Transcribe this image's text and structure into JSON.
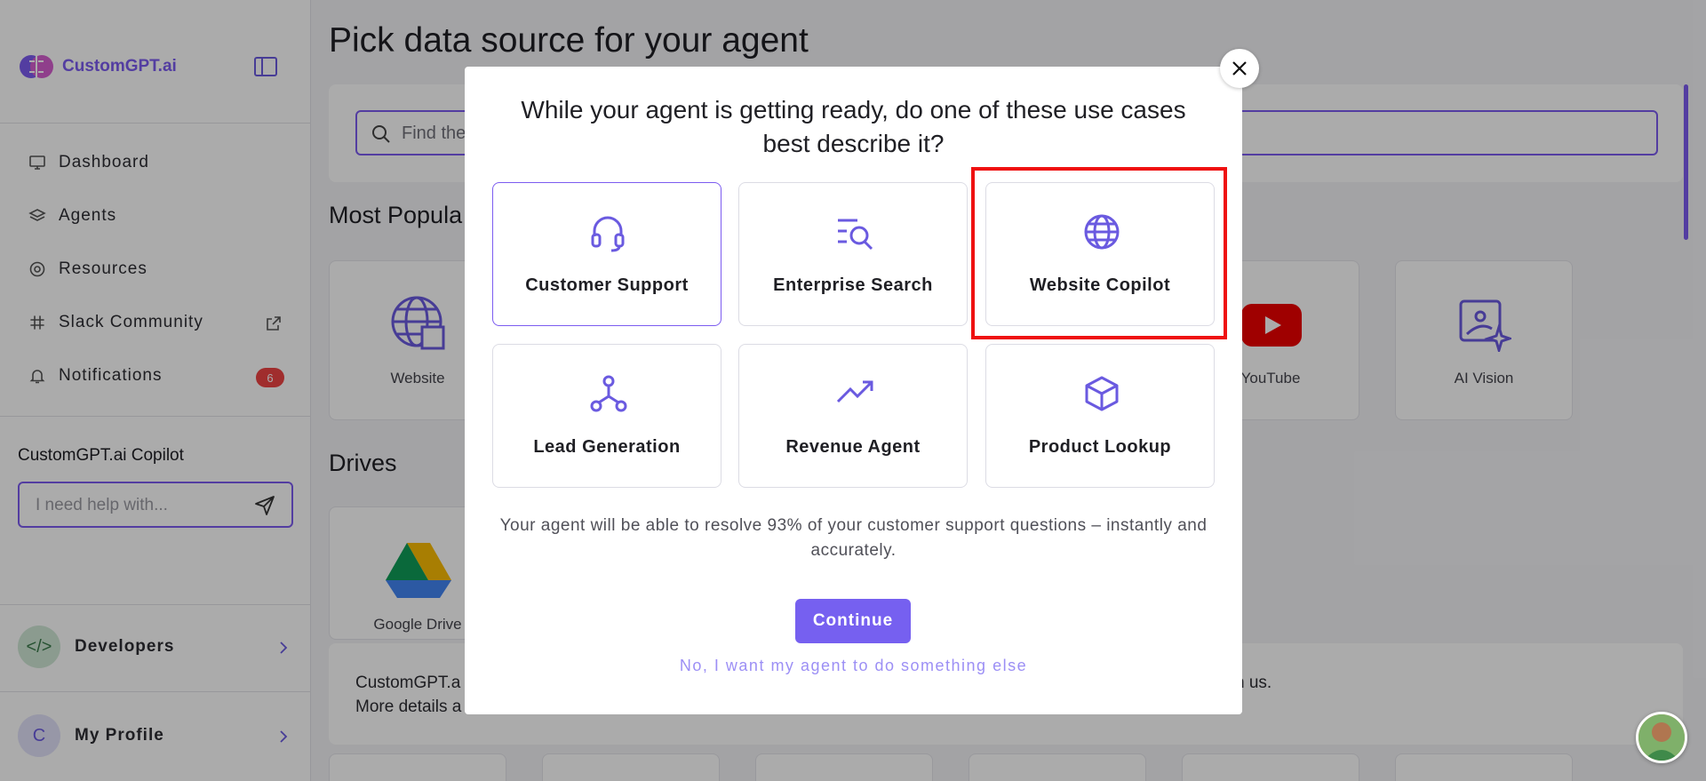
{
  "sidebar": {
    "brand": "CustomGPT.ai",
    "nav": [
      {
        "label": "Dashboard",
        "icon": "dashboard-icon"
      },
      {
        "label": "Agents",
        "icon": "layers-icon"
      },
      {
        "label": "Resources",
        "icon": "lifebuoy-icon"
      },
      {
        "label": "Slack Community",
        "icon": "slack-icon"
      },
      {
        "label": "Notifications",
        "icon": "bell-icon",
        "badge": "6"
      }
    ],
    "copilot": {
      "title": "CustomGPT.ai Copilot",
      "placeholder": "I need help with..."
    },
    "developers": {
      "label": "Developers"
    },
    "profile": {
      "label": "My Profile",
      "initial": "C"
    }
  },
  "main": {
    "title": "Pick data source for your agent",
    "search_placeholder": "Find the",
    "most_popular": "Most Popula",
    "cards": [
      {
        "label": "Website",
        "icon": "globe-link-icon"
      },
      {
        "label": "YouTube",
        "icon": "youtube-icon"
      },
      {
        "label": "AI Vision",
        "icon": "ai-vision-icon"
      }
    ],
    "drives_title": "Drives",
    "drive_cards": [
      {
        "label": "Google Drive",
        "icon": "google-drive-icon"
      }
    ],
    "info_line1_left": "CustomGPT.a",
    "info_line1_right": "n us.",
    "info_line2_left": "More details a"
  },
  "modal": {
    "question": "While your agent is getting ready, do one of these use cases best describe it?",
    "options": [
      {
        "label": "Customer Support",
        "icon": "headset-icon",
        "selected": true
      },
      {
        "label": "Enterprise Search",
        "icon": "search-list-icon",
        "selected": false
      },
      {
        "label": "Website Copilot",
        "icon": "globe-icon",
        "selected": false
      },
      {
        "label": "Lead Generation",
        "icon": "network-icon",
        "selected": false
      },
      {
        "label": "Revenue Agent",
        "icon": "trending-up-icon",
        "selected": false
      },
      {
        "label": "Product Lookup",
        "icon": "box-icon",
        "selected": false
      }
    ],
    "description": "Your agent will be able to resolve 93% of your customer support questions – instantly and accurately.",
    "continue_label": "Continue",
    "alt_label": "No, I want my agent to do something else"
  },
  "colors": {
    "accent": "#7660f0",
    "highlight": "#ef1111",
    "badge": "#ef4444"
  }
}
